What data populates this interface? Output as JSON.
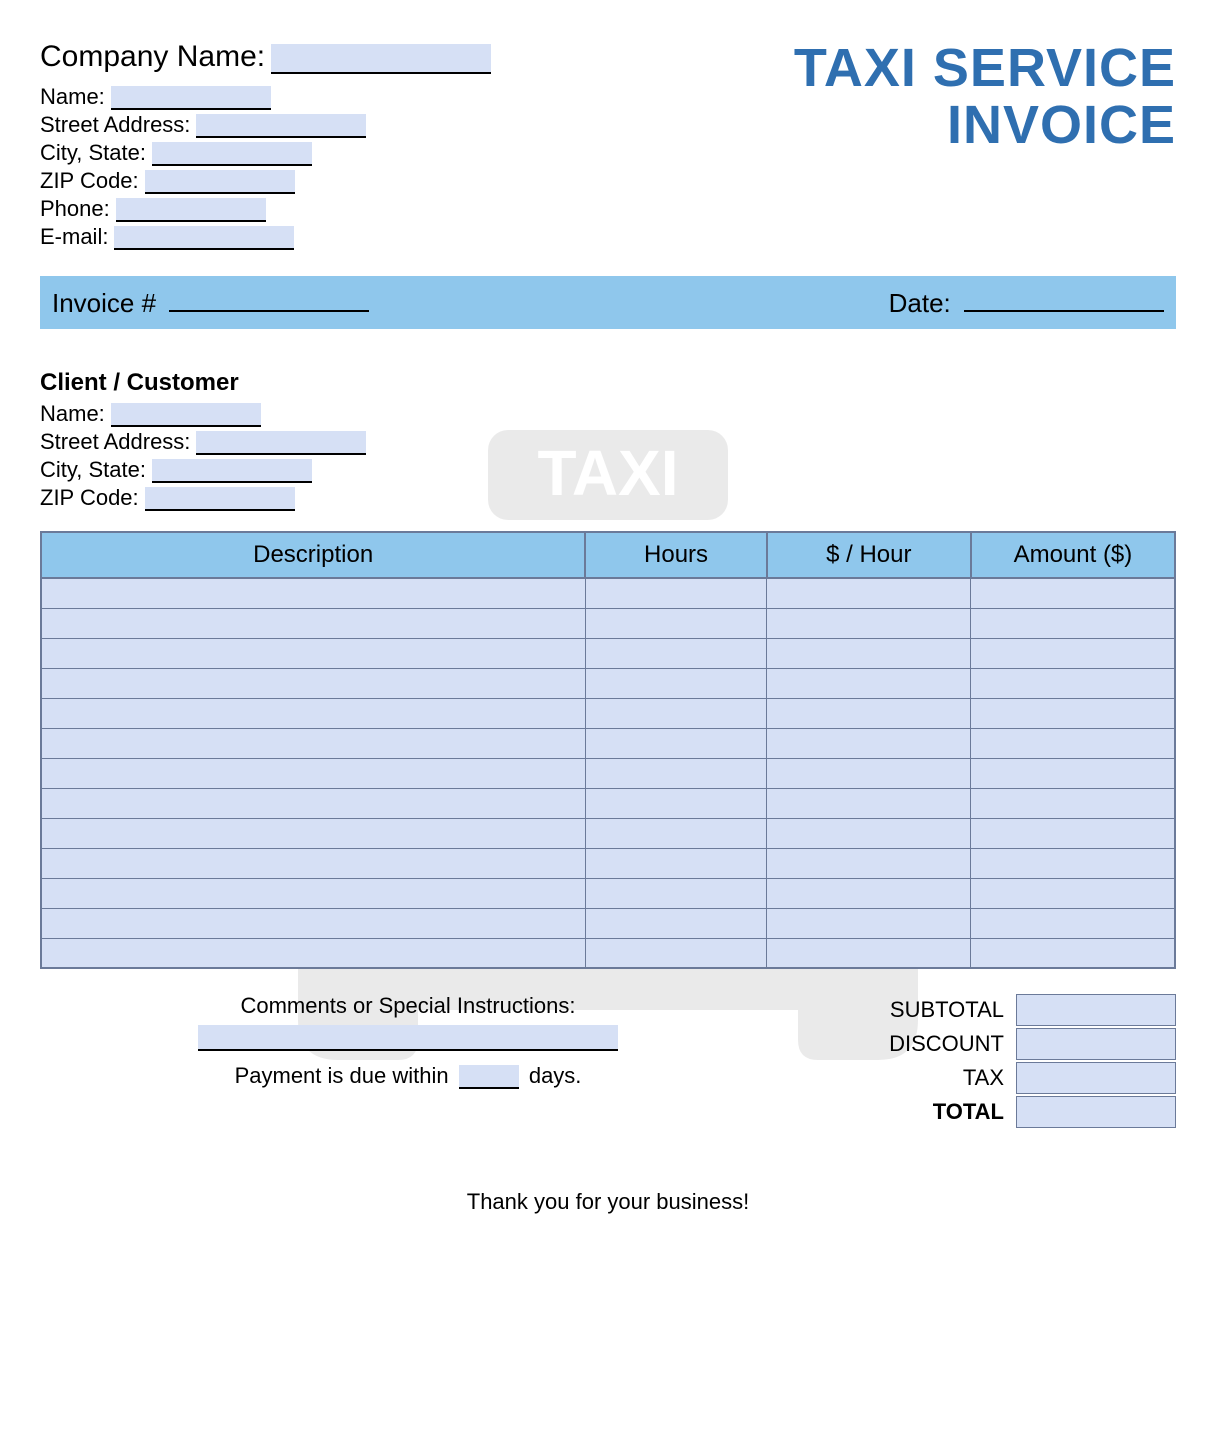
{
  "title_line1": "TAXI SERVICE",
  "title_line2": "INVOICE",
  "company": {
    "company_name_label": "Company Name:",
    "name_label": "Name:",
    "street_label": "Street Address:",
    "city_state_label": "City, State:",
    "zip_label": "ZIP Code:",
    "phone_label": "Phone:",
    "email_label": "E-mail:",
    "company_name": "",
    "name": "",
    "street": "",
    "city_state": "",
    "zip": "",
    "phone": "",
    "email": ""
  },
  "invoice_bar": {
    "invoice_label": "Invoice #",
    "invoice_number": "",
    "date_label": "Date:",
    "date": ""
  },
  "client": {
    "heading": "Client / Customer",
    "name_label": "Name:",
    "street_label": "Street Address:",
    "city_state_label": "City, State:",
    "zip_label": "ZIP Code:",
    "name": "",
    "street": "",
    "city_state": "",
    "zip": ""
  },
  "table": {
    "headers": {
      "description": "Description",
      "hours": "Hours",
      "rate": "$ / Hour",
      "amount": "Amount ($)"
    },
    "rows": [
      {
        "description": "",
        "hours": "",
        "rate": "",
        "amount": ""
      },
      {
        "description": "",
        "hours": "",
        "rate": "",
        "amount": ""
      },
      {
        "description": "",
        "hours": "",
        "rate": "",
        "amount": ""
      },
      {
        "description": "",
        "hours": "",
        "rate": "",
        "amount": ""
      },
      {
        "description": "",
        "hours": "",
        "rate": "",
        "amount": ""
      },
      {
        "description": "",
        "hours": "",
        "rate": "",
        "amount": ""
      },
      {
        "description": "",
        "hours": "",
        "rate": "",
        "amount": ""
      },
      {
        "description": "",
        "hours": "",
        "rate": "",
        "amount": ""
      },
      {
        "description": "",
        "hours": "",
        "rate": "",
        "amount": ""
      },
      {
        "description": "",
        "hours": "",
        "rate": "",
        "amount": ""
      },
      {
        "description": "",
        "hours": "",
        "rate": "",
        "amount": ""
      },
      {
        "description": "",
        "hours": "",
        "rate": "",
        "amount": ""
      },
      {
        "description": "",
        "hours": "",
        "rate": "",
        "amount": ""
      }
    ]
  },
  "comments": {
    "heading": "Comments or Special Instructions:",
    "text": "",
    "payment_prefix": "Payment is due within",
    "payment_days": "",
    "payment_suffix": "days."
  },
  "totals": {
    "subtotal_label": "SUBTOTAL",
    "discount_label": "DISCOUNT",
    "tax_label": "TAX",
    "total_label": "TOTAL",
    "subtotal": "",
    "discount": "",
    "tax": "",
    "total": ""
  },
  "thank_you": "Thank you for your business!",
  "watermark_text": "TAXI"
}
